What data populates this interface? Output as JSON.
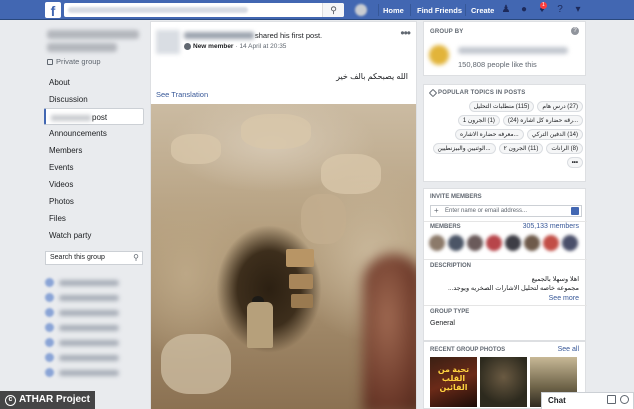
{
  "topbar": {
    "logo": "f",
    "nav": [
      "Home",
      "Find Friends",
      "Create"
    ],
    "notification_count": "1"
  },
  "left": {
    "privacy": "Private group",
    "nav": [
      {
        "label": "About"
      },
      {
        "label": "Discussion"
      },
      {
        "label": "post",
        "active": true
      },
      {
        "label": "Announcements"
      },
      {
        "label": "Members"
      },
      {
        "label": "Events"
      },
      {
        "label": "Videos"
      },
      {
        "label": "Photos"
      },
      {
        "label": "Files"
      },
      {
        "label": "Watch party"
      }
    ],
    "search_placeholder": "Search this group"
  },
  "post": {
    "action": "shared his first post.",
    "badge": "New member",
    "time": "· 14 April at 20:35",
    "text": "الله يصبحكم بالف خير",
    "see_translation": "See Translation"
  },
  "watermark": {
    "label": "ATHAR Project",
    "symbol": "c"
  },
  "right": {
    "group_by": {
      "heading": "GROUP BY",
      "likes": "150,808 people like this"
    },
    "topics": {
      "heading": "POPULAR TOPICS IN POSTS",
      "chips": [
        "(27) درس هام",
        "(115) منطلبات التحليل",
        "...رقه حضاره كل اشاره (24)",
        "(1) الجرون 1",
        "(14) الدفين التركي",
        "...معرفه حضاره الاشاره",
        "(8) الرانات",
        "(11) الجرون ٢",
        "...الوثنيين والبيزنطيين",
        "•••"
      ]
    },
    "invite": {
      "heading": "INVITE MEMBERS",
      "placeholder": "Enter name or email address..."
    },
    "members": {
      "heading": "MEMBERS",
      "count": "305,133 members"
    },
    "description": {
      "heading": "DESCRIPTION",
      "line1": "اهلا وسهلا بالجميع",
      "line2": "مجموعه خاصه لتحليل الاشارات الصخريه ويوجد...",
      "see_more": "See more"
    },
    "group_type": {
      "heading": "GROUP TYPE",
      "value": "General"
    },
    "recent_photos": {
      "heading": "RECENT GROUP PHOTOS",
      "see_all": "See all",
      "photo1_text": "تحية من القلب الفائين"
    }
  },
  "chat": {
    "label": "Chat"
  }
}
